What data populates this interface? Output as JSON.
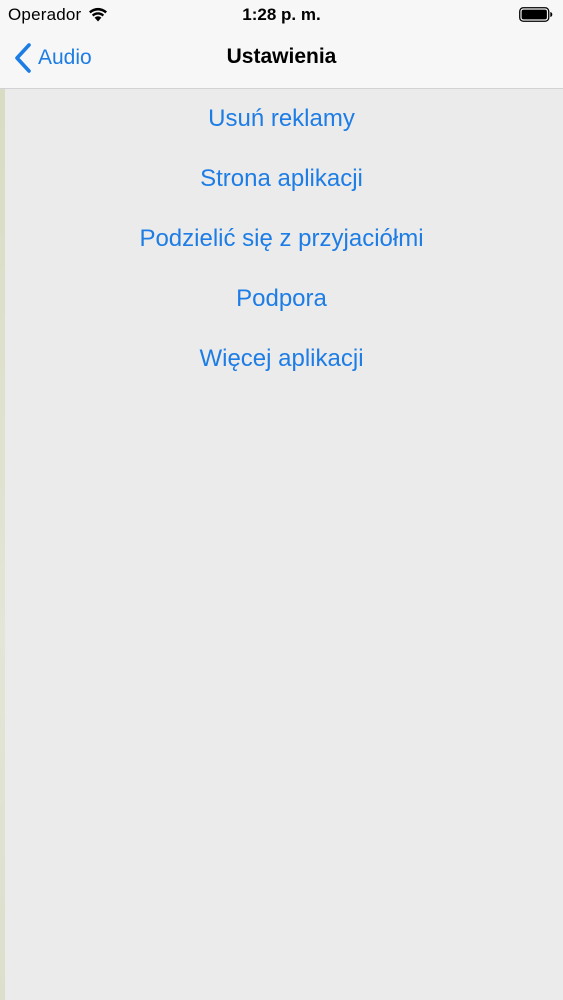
{
  "status_bar": {
    "carrier": "Operador",
    "time": "1:28 p. m.",
    "wifi_icon": "wifi-icon",
    "battery_icon": "battery-full-icon"
  },
  "nav_bar": {
    "back_label": "Audio",
    "back_icon": "chevron-left-icon",
    "title": "Ustawienia"
  },
  "menu": {
    "items": [
      {
        "label": "Usuń reklamy"
      },
      {
        "label": "Strona aplikacji"
      },
      {
        "label": "Podzielić się z przyjaciółmi"
      },
      {
        "label": "Podpora"
      },
      {
        "label": "Więcej aplikacji"
      }
    ]
  },
  "colors": {
    "accent": "#1d7de5",
    "background": "#ebebec",
    "bar": "#f7f7f8"
  }
}
